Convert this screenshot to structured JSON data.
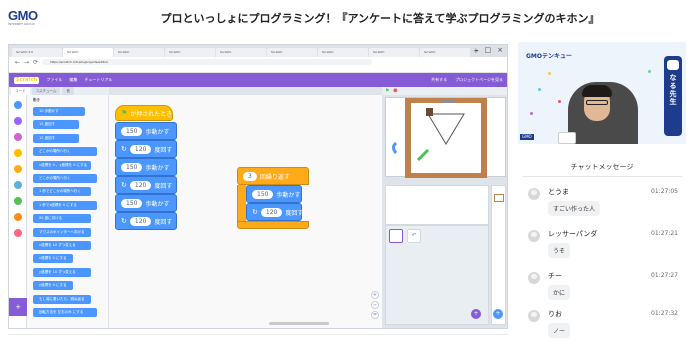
{
  "header": {
    "logo": "GMO",
    "logo_sub": "INTERNET GROUP",
    "title": "プロといっしょにプログラミング！『アンケートに答えて学ぶプログラミングのキホン』"
  },
  "browser": {
    "tabs": [
      "Scratch 3.0",
      "Scratch",
      "Scratch",
      "Scratch",
      "Scratch",
      "Scratch",
      "Scratch",
      "Scratch",
      "Scratch"
    ],
    "new_tab": "+",
    "controls": [
      "–",
      "□",
      "×"
    ],
    "nav": [
      "←",
      "→",
      "⟳"
    ],
    "url": "https://scratch.mit.edu/projects/editor/"
  },
  "scratch": {
    "logo": "Scratch",
    "menu": [
      "ファイル",
      "編集",
      "チュートリアル"
    ],
    "menu_right": [
      "共有する",
      "プロジェクトページを見る"
    ],
    "code_tabs": [
      "コード",
      "コスチューム",
      "音"
    ],
    "palette_head": "動き",
    "palette": [
      {
        "text": "10 歩動かす",
        "pill": "10"
      },
      {
        "text": "15 度回す",
        "pill": "15"
      },
      {
        "text": "15 度回す",
        "pill": "15"
      },
      {
        "text": "どこかの場所へ行く",
        "pill": ""
      },
      {
        "text": "x座標を 0 、y座標を 0 にする",
        "pill": "0"
      },
      {
        "text": "どこかの場所へ行く",
        "pill": ""
      },
      {
        "text": "1 秒でどこかの場所へ行く",
        "pill": "1"
      },
      {
        "text": "1 秒でx座標を 0 にする",
        "pill": "1"
      },
      {
        "text": "90 度に向ける",
        "pill": "90"
      },
      {
        "text": "マウスのポインターへ向ける",
        "pill": ""
      },
      {
        "text": "x座標を 10 ずつ変える",
        "pill": "10"
      },
      {
        "text": "x座標を 0 にする",
        "pill": "0"
      },
      {
        "text": "y座標を 10 ずつ変える",
        "pill": "10"
      },
      {
        "text": "y座標を 0 にする",
        "pill": "0"
      },
      {
        "text": "もし端に着いたら、跳ね返る",
        "pill": ""
      },
      {
        "text": "回転方法を 左右のみ にする",
        "pill": ""
      }
    ],
    "script1": {
      "hat": "が押されたとき",
      "blocks": [
        {
          "verb": "歩動かす",
          "value": "150"
        },
        {
          "verb": "度回す",
          "value": "120"
        },
        {
          "verb": "歩動かす",
          "value": "150"
        },
        {
          "verb": "度回す",
          "value": "120"
        },
        {
          "verb": "歩動かす",
          "value": "150"
        },
        {
          "verb": "度回す",
          "value": "120"
        }
      ]
    },
    "script2": {
      "repeat_value": "3",
      "repeat_label": "回繰り返す",
      "blocks": [
        {
          "verb": "歩動かす",
          "value": "150"
        },
        {
          "verb": "度回す",
          "value": "120"
        }
      ]
    },
    "zoom": [
      "+",
      "−",
      "="
    ],
    "extension": "+"
  },
  "webcam": {
    "brand": "GMOテンキュー",
    "badge": "GMO",
    "banner": "なる先生"
  },
  "chat": {
    "title": "チャットメッセージ",
    "messages": [
      {
        "name": "とうま",
        "time": "01:27:05",
        "text": "すごい作った人"
      },
      {
        "name": "レッサーパンダ",
        "time": "01:27:21",
        "text": "うそ"
      },
      {
        "name": "チー",
        "time": "01:27:27",
        "text": "かに"
      },
      {
        "name": "りお",
        "time": "01:27:32",
        "text": "ノー"
      }
    ]
  },
  "colors": {
    "scratch_purple": "#855cd6",
    "motion_blue": "#4c97ff",
    "events_yellow": "#ffbf00",
    "control_orange": "#ffab19",
    "gmo_blue": "#1d3d8c"
  }
}
